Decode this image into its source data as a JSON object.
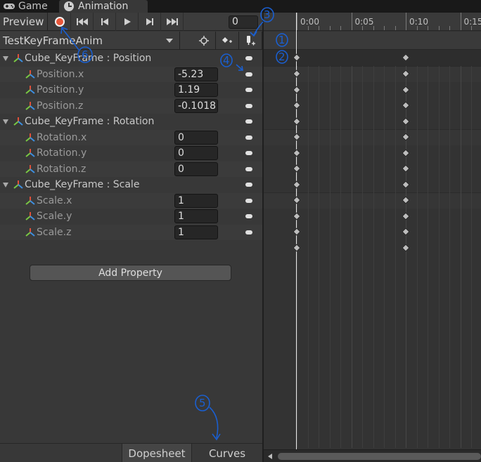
{
  "tabs": [
    {
      "label": "Game",
      "icon": "gamepad-icon"
    },
    {
      "label": "Animation",
      "icon": "clock-icon"
    }
  ],
  "toolbar": {
    "preview_label": "Preview",
    "record_color": "#e8563a",
    "frame_value": "0"
  },
  "clip": {
    "name": "TestKeyFrameAnim"
  },
  "properties": [
    {
      "label": "Cube_KeyFrame : Position",
      "type": "group"
    },
    {
      "label": "Position.x",
      "value": "-5.23",
      "type": "child"
    },
    {
      "label": "Position.y",
      "value": "1.19",
      "type": "child"
    },
    {
      "label": "Position.z",
      "value": "-0.1018",
      "type": "child"
    },
    {
      "label": "Cube_KeyFrame : Rotation",
      "type": "group"
    },
    {
      "label": "Rotation.x",
      "value": "0",
      "type": "child"
    },
    {
      "label": "Rotation.y",
      "value": "0",
      "type": "child"
    },
    {
      "label": "Rotation.z",
      "value": "0",
      "type": "child"
    },
    {
      "label": "Cube_KeyFrame : Scale",
      "type": "group"
    },
    {
      "label": "Scale.x",
      "value": "1",
      "type": "child"
    },
    {
      "label": "Scale.y",
      "value": "1",
      "type": "child"
    },
    {
      "label": "Scale.z",
      "value": "1",
      "type": "child"
    }
  ],
  "add_property_label": "Add Property",
  "bottom_tabs": {
    "dopesheet": "Dopesheet",
    "curves": "Curves"
  },
  "timeline": {
    "ticks": [
      "0:00",
      "0:05",
      "0:10",
      "0:15"
    ],
    "keyframe_times": [
      "0:00",
      "0:10"
    ]
  },
  "annotations": [
    "1",
    "2",
    "3",
    "4",
    "5",
    "6"
  ],
  "annotation_color": "#1a5fd0"
}
